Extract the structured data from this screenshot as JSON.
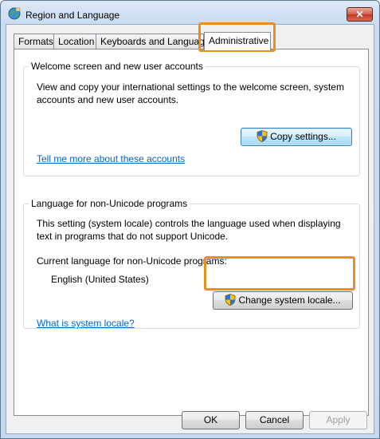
{
  "window": {
    "title": "Region and Language",
    "close_label": "✕"
  },
  "tabs": [
    {
      "label": "Formats"
    },
    {
      "label": "Location"
    },
    {
      "label": "Keyboards and Languages"
    },
    {
      "label": "Administrative"
    }
  ],
  "active_tab": "Administrative",
  "welcome_group": {
    "title": "Welcome screen and new user accounts",
    "description": "View and copy your international settings to the welcome screen, system accounts and new user accounts.",
    "copy_button_label": "Copy settings...",
    "help_link": "Tell me more about these accounts"
  },
  "locale_group": {
    "title": "Language for non-Unicode programs",
    "description": "This setting (system locale) controls the language used when displaying text in programs that do not support Unicode.",
    "current_label": "Current language for non-Unicode programs:",
    "current_value": "English (United States)",
    "change_button_label": "Change system locale...",
    "help_link": "What is system locale?"
  },
  "footer": {
    "ok_label": "OK",
    "cancel_label": "Cancel",
    "apply_label": "Apply"
  },
  "colors": {
    "highlight": "#e8901c",
    "link": "#0066cc"
  }
}
